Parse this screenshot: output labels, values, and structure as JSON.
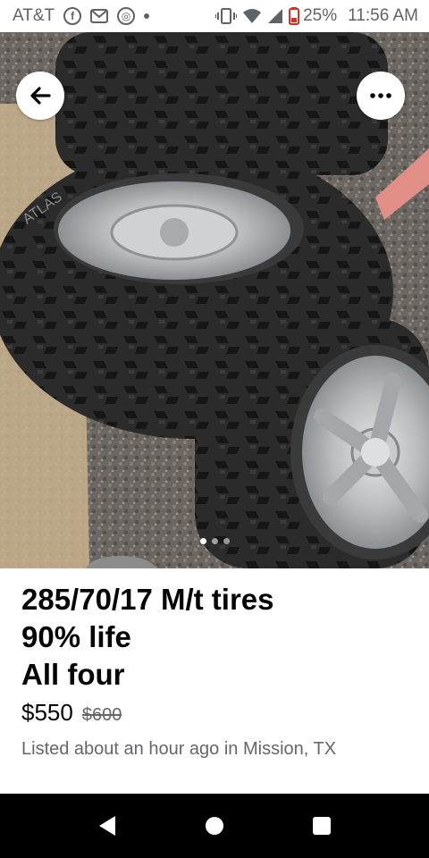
{
  "status_bar": {
    "carrier": "AT&T",
    "battery": "25%",
    "time": "11:56 AM",
    "icons": [
      "facebook-icon",
      "gmail-icon",
      "chrome-icon",
      "dot-icon",
      "vibrate-icon",
      "wifi-icon",
      "signal-icon",
      "battery-icon"
    ]
  },
  "photo": {
    "brand_text": "ATLAS",
    "carousel_index": 1,
    "carousel_total": 3
  },
  "listing": {
    "title_lines": [
      "285/70/17 M/t tires",
      "90% life",
      "All four"
    ],
    "price": "$550",
    "original_price": "$600",
    "meta": "Listed about an hour ago in Mission, TX"
  },
  "nav": [
    "back-icon",
    "home-icon",
    "recents-icon"
  ]
}
